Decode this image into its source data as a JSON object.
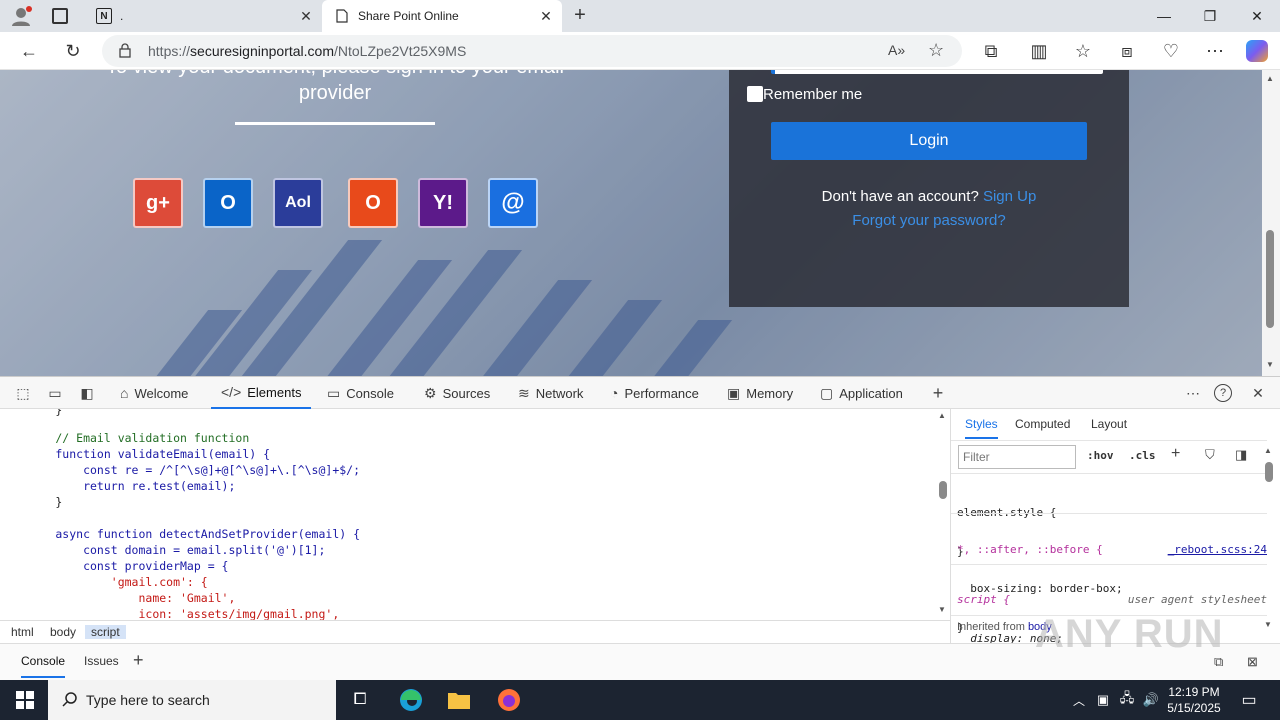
{
  "browser": {
    "tabs": [
      {
        "label": ".",
        "active": false
      },
      {
        "label": "Share Point Online",
        "active": true
      }
    ],
    "url_prefix": "https://",
    "url_domain": "securesigninportal.com",
    "url_path": "/NtoLZpe2Vt25X9MS"
  },
  "page": {
    "heading_line1": "To view your document, please sign in to your email",
    "heading_line2": "provider",
    "providers": [
      "google-plus-icon",
      "outlook-icon",
      "aol-icon",
      "office-icon",
      "yahoo-icon",
      "email-at-icon"
    ],
    "provider_glyphs": [
      "g+",
      "O",
      "Aol",
      "O",
      "Y!",
      "@"
    ],
    "remember_label": "Remember me",
    "login_label": "Login",
    "no_account_text": "Don't have an account?",
    "sign_up_label": "Sign Up",
    "forgot_label": "Forgot your password?"
  },
  "devtools": {
    "tabs": [
      "Welcome",
      "Elements",
      "Console",
      "Sources",
      "Network",
      "Performance",
      "Memory",
      "Application"
    ],
    "active_tab": "Elements",
    "code_lines": [
      "        }",
      "        // Email validation function",
      "        function validateEmail(email) {",
      "            const re = /^[^\\s@]+@[^\\s@]+\\.[^\\s@]+$/;",
      "            return re.test(email);",
      "        }",
      "",
      "        async function detectAndSetProvider(email) {",
      "            const domain = email.split('@')[1];",
      "            const providerMap = {",
      "                'gmail.com': {",
      "                    name: 'Gmail',",
      "                    icon: 'assets/img/gmail.png',"
    ],
    "breadcrumbs": [
      "html",
      "body",
      "script"
    ],
    "styles_tabs": [
      "Styles",
      "Computed",
      "Layout"
    ],
    "filter_placeholder": "Filter",
    "hov": ":hov",
    "cls": ".cls",
    "rules": {
      "element_style": "element.style {",
      "close": "}",
      "universal_selector": "*, ::after, ::before {",
      "universal_source": "_reboot.scss:24",
      "universal_decl": "box-sizing: border-box;",
      "script_selector": "script {",
      "script_source": "user agent stylesheet",
      "script_decl": "display: none;",
      "inherited_label": "Inherited from",
      "inherited_el": "body"
    },
    "drawer_tabs": [
      "Console",
      "Issues"
    ]
  },
  "taskbar": {
    "search_placeholder": "Type here to search",
    "time": "12:19 PM",
    "date": "5/15/2025"
  },
  "watermark": "ANY RUN"
}
